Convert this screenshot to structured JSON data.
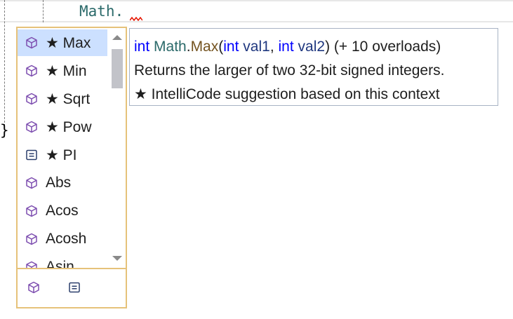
{
  "editor": {
    "code_line": "Math.",
    "closing_brace": "}"
  },
  "completion": {
    "items": [
      {
        "label": "★ Max",
        "kind": "method-icon",
        "selected": true
      },
      {
        "label": "★ Min",
        "kind": "method-icon"
      },
      {
        "label": "★ Sqrt",
        "kind": "method-icon"
      },
      {
        "label": "★ Pow",
        "kind": "method-icon"
      },
      {
        "label": "★ PI",
        "kind": "constant-icon"
      },
      {
        "label": "Abs",
        "kind": "method-icon"
      },
      {
        "label": "Acos",
        "kind": "method-icon"
      },
      {
        "label": "Acosh",
        "kind": "method-icon"
      },
      {
        "label": "Asin",
        "kind": "method-icon"
      }
    ],
    "filters": [
      "method-filter-icon",
      "constant-filter-icon"
    ]
  },
  "tooltip": {
    "return_type": "int",
    "class_name": "Math",
    "dot": ".",
    "method_name": "Max",
    "open_paren": "(",
    "p1_type": "int",
    "p1_name": "val1",
    "comma": ",",
    "p2_type": "int",
    "p2_name": "val2",
    "close_paren": ")",
    "overloads": "(+ 10 overloads)",
    "description": "Returns the larger of two 32-bit signed integers.",
    "intellicode": "★  IntelliCode suggestion based on this context"
  },
  "colors": {
    "border_accent": "#e6c27a",
    "selection": "#cce0ff",
    "method_icon": "#7e4fb0",
    "keyword": "#0000ff",
    "type": "#2b6a6a",
    "method": "#74531f"
  }
}
